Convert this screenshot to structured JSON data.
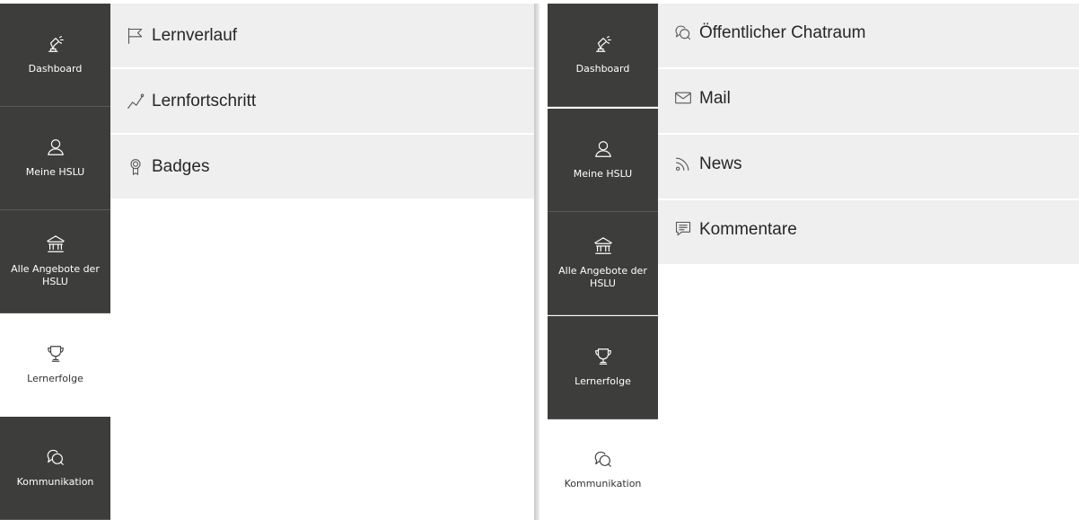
{
  "left_panel": {
    "sidebar": [
      {
        "label": "Dashboard",
        "icon": "dashboard-lamp-icon",
        "active": false
      },
      {
        "label": "Meine HSLU",
        "icon": "user-icon",
        "active": false
      },
      {
        "label": "Alle Angebote der HSLU",
        "icon": "institution-icon",
        "active": false
      },
      {
        "label": "Lernerfolge",
        "icon": "trophy-icon",
        "active": true
      },
      {
        "label": "Kommunikation",
        "icon": "chat-bubbles-icon",
        "active": false
      }
    ],
    "menu": [
      {
        "label": "Lernverlauf",
        "icon": "flag-icon"
      },
      {
        "label": "Lernfortschritt",
        "icon": "progress-line-icon"
      },
      {
        "label": "Badges",
        "icon": "badge-medal-icon"
      }
    ]
  },
  "right_panel": {
    "sidebar": [
      {
        "label": "Dashboard",
        "icon": "dashboard-lamp-icon",
        "active": false
      },
      {
        "label": "Meine HSLU",
        "icon": "user-icon",
        "active": false
      },
      {
        "label": "Alle Angebote der HSLU",
        "icon": "institution-icon",
        "active": false
      },
      {
        "label": "Lernerfolge",
        "icon": "trophy-icon",
        "active": false
      },
      {
        "label": "Kommunikation",
        "icon": "chat-bubbles-icon",
        "active": true
      }
    ],
    "menu": [
      {
        "label": "Öffentlicher Chatraum",
        "icon": "chat-bubbles-icon"
      },
      {
        "label": "Mail",
        "icon": "envelope-icon"
      },
      {
        "label": "News",
        "icon": "rss-feed-icon"
      },
      {
        "label": "Kommentare",
        "icon": "comment-icon"
      }
    ]
  },
  "colors": {
    "sidebar_bg": "#3d3d3c",
    "sidebar_active_bg": "#ffffff",
    "menu_row_bg": "#efefef"
  }
}
